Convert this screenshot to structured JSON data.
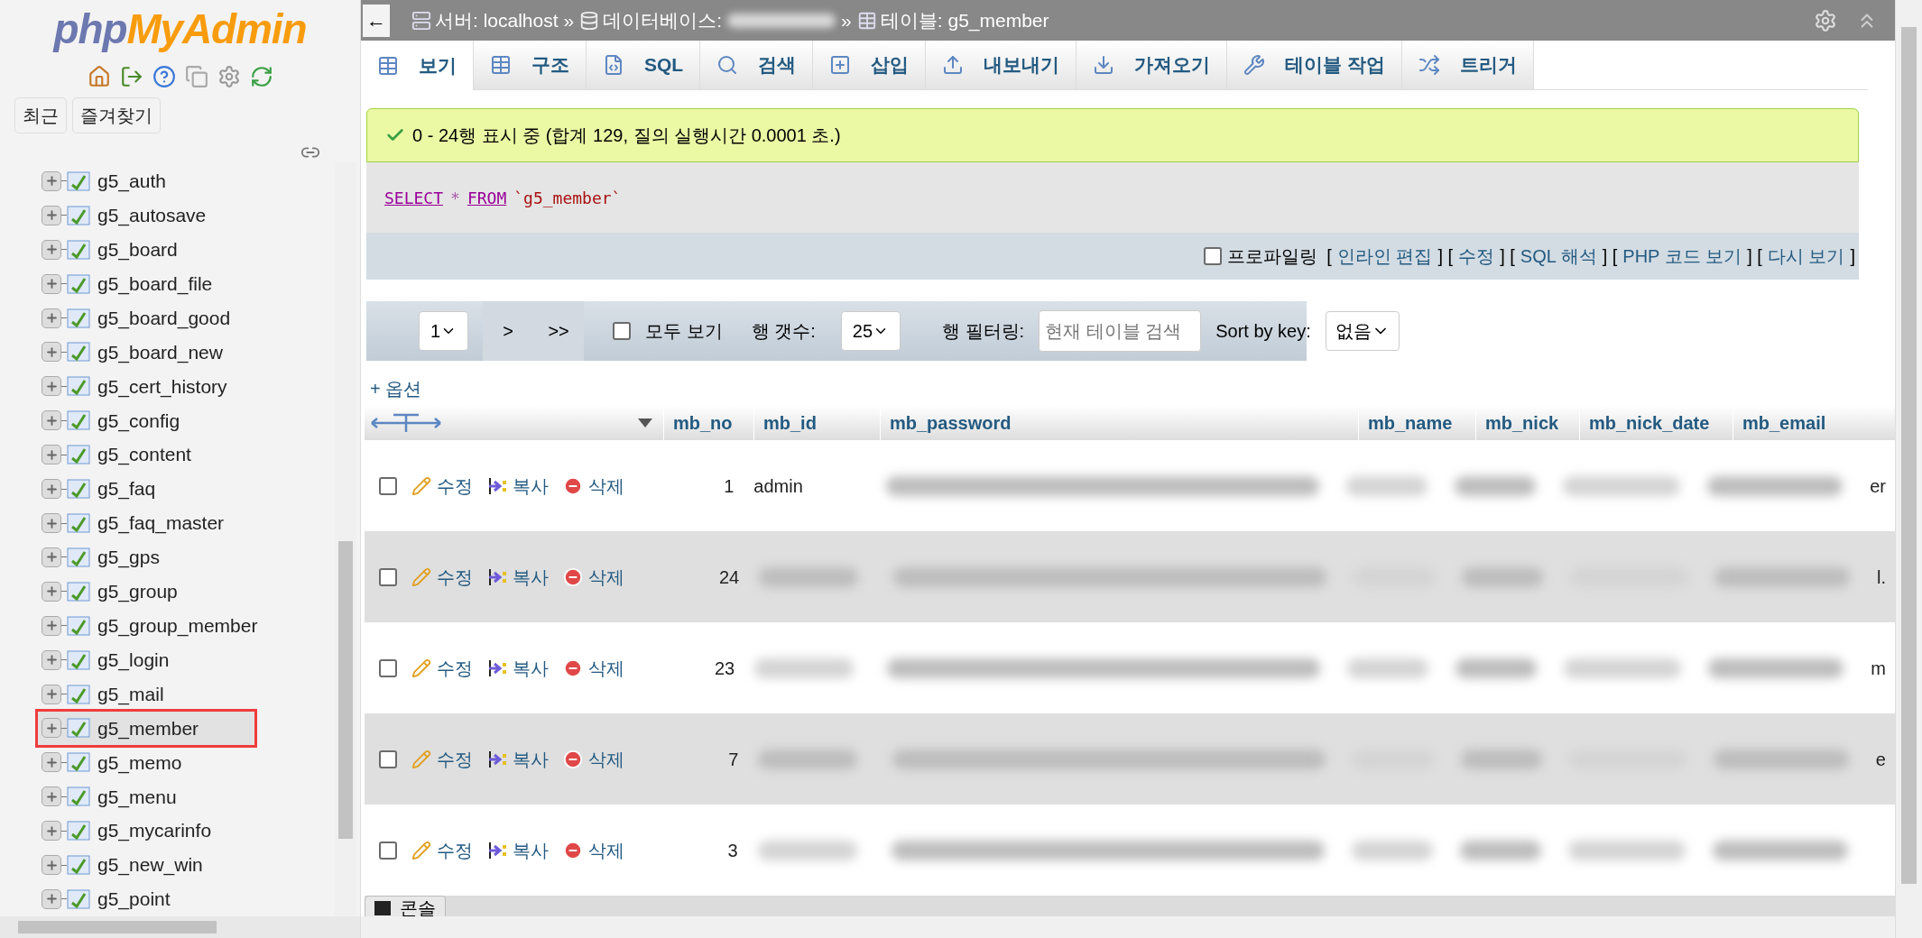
{
  "sidebar": {
    "logo": {
      "first": "php",
      "second": "MyAdmin"
    },
    "buttons": [
      "최근",
      "즐겨찾기"
    ],
    "tables": [
      {
        "name": "g5_auth",
        "selected": false
      },
      {
        "name": "g5_autosave",
        "selected": false
      },
      {
        "name": "g5_board",
        "selected": false
      },
      {
        "name": "g5_board_file",
        "selected": false
      },
      {
        "name": "g5_board_good",
        "selected": false
      },
      {
        "name": "g5_board_new",
        "selected": false
      },
      {
        "name": "g5_cert_history",
        "selected": false
      },
      {
        "name": "g5_config",
        "selected": false
      },
      {
        "name": "g5_content",
        "selected": false
      },
      {
        "name": "g5_faq",
        "selected": false
      },
      {
        "name": "g5_faq_master",
        "selected": false
      },
      {
        "name": "g5_gps",
        "selected": false
      },
      {
        "name": "g5_group",
        "selected": false
      },
      {
        "name": "g5_group_member",
        "selected": false
      },
      {
        "name": "g5_login",
        "selected": false
      },
      {
        "name": "g5_mail",
        "selected": false
      },
      {
        "name": "g5_member",
        "selected": true
      },
      {
        "name": "g5_memo",
        "selected": false
      },
      {
        "name": "g5_menu",
        "selected": false
      },
      {
        "name": "g5_mycarinfo",
        "selected": false
      },
      {
        "name": "g5_new_win",
        "selected": false
      },
      {
        "name": "g5_point",
        "selected": false
      }
    ]
  },
  "header": {
    "back": "←",
    "crumbs": [
      {
        "kind": "server",
        "text": "서버: localhost"
      },
      {
        "kind": "separator",
        "text": "»"
      },
      {
        "kind": "database",
        "text": "데이터베이스:"
      },
      {
        "kind": "hidden"
      },
      {
        "kind": "separator",
        "text": "»"
      },
      {
        "kind": "table",
        "text": "테이블: g5_member"
      }
    ]
  },
  "tabs": [
    {
      "label": "보기",
      "kind": "browse",
      "selected": true
    },
    {
      "label": "구조",
      "kind": "structure",
      "selected": false
    },
    {
      "label": "SQL",
      "kind": "sql",
      "selected": false
    },
    {
      "label": "검색",
      "kind": "search",
      "selected": false
    },
    {
      "label": "삽입",
      "kind": "insert",
      "selected": false
    },
    {
      "label": "내보내기",
      "kind": "export",
      "selected": false
    },
    {
      "label": "가져오기",
      "kind": "import",
      "selected": false
    },
    {
      "label": "테이블 작업",
      "kind": "operations",
      "selected": false
    },
    {
      "label": "트리거",
      "kind": "triggers",
      "selected": false
    }
  ],
  "message": "0 - 24행 표시 중 (합계 129, 질의 실행시간 0.0001 초.)",
  "query": [
    {
      "kind": "keyword",
      "text": "SELECT"
    },
    {
      "kind": "operator",
      "text": "*"
    },
    {
      "kind": "keyword",
      "text": "FROM"
    },
    {
      "kind": "name",
      "text": "`g5_member`"
    }
  ],
  "profiling": {
    "label": "프로파일링",
    "checked": false
  },
  "query_links": [
    {
      "kind": "bracket",
      "text": "["
    },
    {
      "kind": "link",
      "text": "인라인 편집"
    },
    {
      "kind": "bracket",
      "text": "] ["
    },
    {
      "kind": "link",
      "text": "수정"
    },
    {
      "kind": "bracket",
      "text": "] ["
    },
    {
      "kind": "link",
      "text": "SQL 해석"
    },
    {
      "kind": "bracket",
      "text": "] ["
    },
    {
      "kind": "link",
      "text": "PHP 코드 보기"
    },
    {
      "kind": "bracket",
      "text": "] ["
    },
    {
      "kind": "link",
      "text": "다시 보기"
    },
    {
      "kind": "bracket",
      "text": "]"
    }
  ],
  "pager": {
    "page": "1",
    "next": ">",
    "last": ">>",
    "show_all": {
      "label": "모두 보기",
      "checked": false
    },
    "rows_label": "행 갯수:",
    "rows": "25",
    "filter_label": "행 필터링:",
    "filter_placeholder": "현재 테이블 검색",
    "sort_label": "Sort by key:",
    "sort": "없음"
  },
  "options": "+ 옵션",
  "columns": [
    "mb_no",
    "mb_id",
    "mb_password",
    "mb_name",
    "mb_nick",
    "mb_nick_date",
    "mb_email"
  ],
  "rows": [
    {
      "checked": false,
      "actions": [
        "수정",
        "복사",
        "삭제"
      ],
      "mb_no": "1",
      "mb_id": "admin",
      "email_tail": "er"
    },
    {
      "checked": false,
      "actions": [
        "수정",
        "복사",
        "삭제"
      ],
      "mb_no": "24",
      "email_tail": "l."
    },
    {
      "checked": false,
      "actions": [
        "수정",
        "복사",
        "삭제"
      ],
      "mb_no": "23",
      "email_tail": "m"
    },
    {
      "checked": false,
      "actions": [
        "수정",
        "복사",
        "삭제"
      ],
      "mb_no": "7",
      "email_tail": "e"
    },
    {
      "checked": false,
      "actions": [
        "수정",
        "복사",
        "삭제"
      ],
      "mb_no": "3"
    }
  ],
  "console": "콘솔"
}
